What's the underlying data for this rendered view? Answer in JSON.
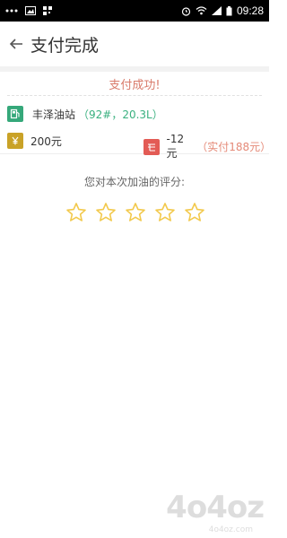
{
  "status_bar": {
    "time": "09:28",
    "left_icons": [
      "more-dots-icon",
      "image-icon",
      "qr-icon"
    ],
    "right_icons": [
      "alarm-icon",
      "wifi-icon",
      "signal-icon",
      "battery-icon"
    ]
  },
  "header": {
    "back_icon": "arrow-left-icon",
    "title": "支付完成"
  },
  "payment": {
    "success_text": "支付成功!",
    "station_name": "丰泽油站",
    "station_detail": "（92#，20.3L）",
    "amount": "200元",
    "discount": "-12元",
    "paid_text": "（实付188元）"
  },
  "rating": {
    "prompt": "您对本次加油的评分:",
    "stars": [
      {
        "name": "star-1"
      },
      {
        "name": "star-2"
      },
      {
        "name": "star-3"
      },
      {
        "name": "star-4"
      },
      {
        "name": "star-5"
      }
    ],
    "filled_stars": 0
  },
  "watermark": {
    "logo": "4o4oz",
    "sub": "4o4oz.com"
  },
  "colors": {
    "success": "#d97b6b",
    "station_icon": "#35a87a",
    "yuan_icon": "#c9a227",
    "discount_icon": "#e35b55",
    "detail_green": "#39b07f",
    "star": "#f2c94c"
  }
}
